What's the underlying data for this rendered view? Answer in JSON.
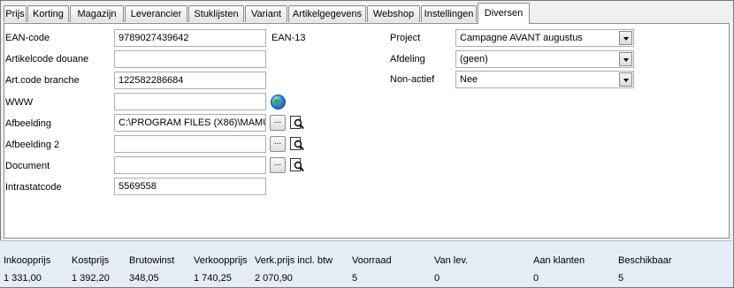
{
  "tabs": [
    "Prijs",
    "Korting",
    "Magazijn",
    "Leverancier",
    "Stuklijsten",
    "Variant",
    "Artikelgegevens",
    "Webshop",
    "Instellingen",
    "Diversen"
  ],
  "fields": {
    "ean": {
      "label": "EAN-code",
      "value": "9789027439642",
      "suffix": "EAN-13"
    },
    "douane": {
      "label": "Artikelcode douane",
      "value": ""
    },
    "branche": {
      "label": "Art.code branche",
      "value": "122582286684"
    },
    "www": {
      "label": "WWW",
      "value": ""
    },
    "afbeelding": {
      "label": "Afbeelding",
      "value": "C:\\PROGRAM FILES (X86)\\MAMU"
    },
    "afbeelding2": {
      "label": "Afbeelding 2",
      "value": ""
    },
    "document": {
      "label": "Document",
      "value": ""
    },
    "intrastat": {
      "label": "Intrastatcode",
      "value": "5569558"
    }
  },
  "right_fields": {
    "project": {
      "label": "Project",
      "value": "Campagne AVANT augustus"
    },
    "afdeling": {
      "label": "Afdeling",
      "value": "(geen)"
    },
    "nonactief": {
      "label": "Non-actief",
      "value": "Nee"
    }
  },
  "browse_button_label": "...",
  "icons": {
    "www": "globe-icon",
    "view": "magnifier-document-icon",
    "dropdown": "chevron-down-icon"
  },
  "status": {
    "headers": [
      "Inkoopprijs",
      "Kostprijs",
      "Brutowinst",
      "Verkoopprijs",
      "Verk.prijs incl. btw",
      "Voorraad",
      "Van lev.",
      "Aan klanten",
      "Beschikbaar"
    ],
    "values": [
      "1 331,00",
      "1 392,20",
      "348,05",
      "1 740,25",
      "2 070,90",
      "5",
      "0",
      "0",
      "5"
    ]
  }
}
